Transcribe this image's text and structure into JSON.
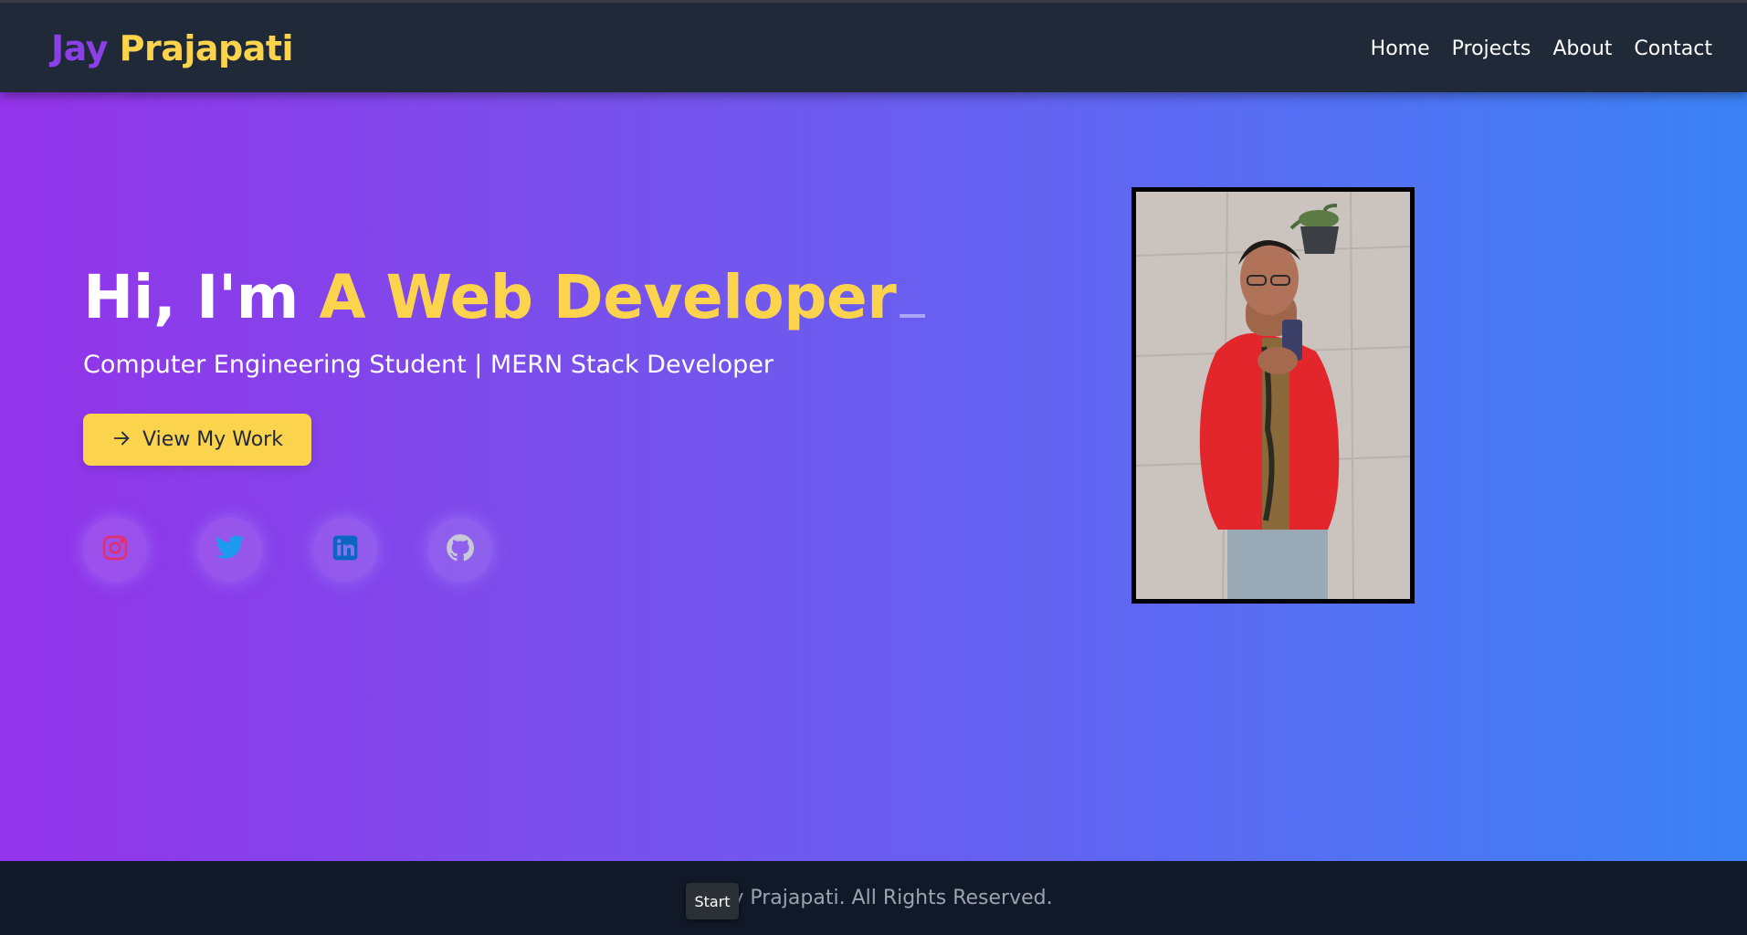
{
  "header": {
    "logo_first": "Jay",
    "logo_last": "Prajapati",
    "nav": [
      {
        "label": "Home"
      },
      {
        "label": "Projects"
      },
      {
        "label": "About"
      },
      {
        "label": "Contact"
      }
    ]
  },
  "hero": {
    "greeting": "Hi, I'm",
    "typed_text": "A Web Developer",
    "subtitle": "Computer Engineering Student | MERN Stack Developer",
    "cta_label": "View My Work",
    "cta_icon": "arrow-right-icon",
    "socials": [
      {
        "icon": "instagram-icon",
        "color": "#e1306c"
      },
      {
        "icon": "twitter-icon",
        "color": "#1da1f2"
      },
      {
        "icon": "linkedin-icon",
        "color": "#0a66c2"
      },
      {
        "icon": "github-icon",
        "color": "#c8c8d8"
      }
    ],
    "photo_icon": "profile-photo"
  },
  "footer": {
    "copyright": "4 Jay Prajapati. All Rights Reserved.",
    "start_label": "Start"
  },
  "colors": {
    "accent": "#fcd34d",
    "logo_first": "#8b3fe6",
    "gradient_start": "#9333ea",
    "gradient_end": "#3b82f6",
    "header_bg": "#1f2937",
    "footer_bg": "#111827"
  }
}
